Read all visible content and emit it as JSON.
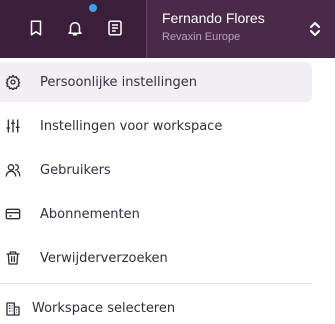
{
  "topbar": {
    "icons": [
      "bookmark-icon",
      "bell-icon",
      "newspaper-icon"
    ],
    "user": {
      "name": "Fernando Flores",
      "org": "Revaxin Europe"
    },
    "colors": {
      "background": "#3b1f3a",
      "user_box": "#4a2a48",
      "notification_dot": "#3aa0f0"
    }
  },
  "menu": {
    "items": [
      {
        "label": "Persoonlijke instellingen",
        "icon": "gear-icon",
        "active": true
      },
      {
        "label": "Instellingen voor workspace",
        "icon": "sliders-icon",
        "active": false
      },
      {
        "label": "Gebruikers",
        "icon": "users-icon",
        "active": false
      },
      {
        "label": "Abonnementen",
        "icon": "credit-card-icon",
        "active": false
      },
      {
        "label": "Verwijderverzoeken",
        "icon": "trash-icon",
        "active": false
      }
    ],
    "workspace_select": {
      "label": "Workspace selecteren",
      "icon": "building-icon"
    }
  }
}
